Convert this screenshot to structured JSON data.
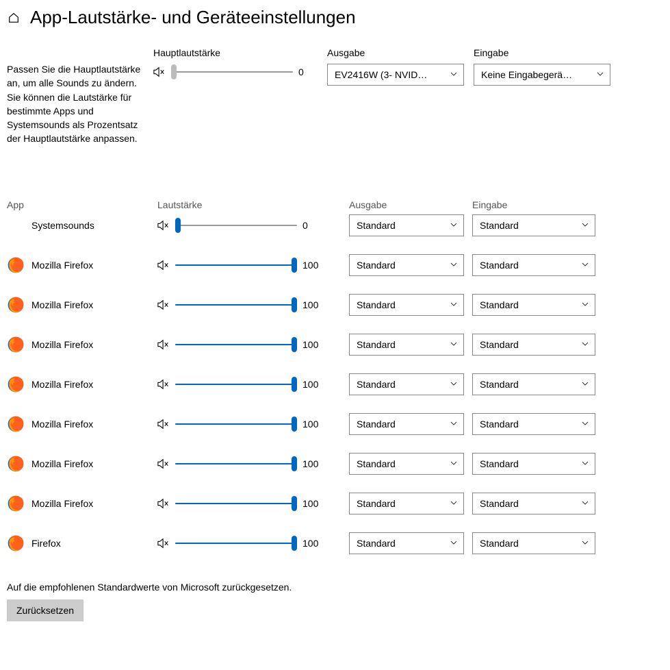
{
  "header": {
    "title": "App-Lautstärke- und Geräteeinstellungen"
  },
  "description": "Passen Sie die Hauptlautstärke an, um alle Sounds zu ändern. Sie können die Lautstärke für bestimmte Apps und Systemsounds als Prozentsatz der Hauptlautstärke anpassen.",
  "master": {
    "volume_label": "Hauptlautstärke",
    "volume_value": "0",
    "output_label": "Ausgabe",
    "output_value": "EV2416W (3- NVID…",
    "input_label": "Eingabe",
    "input_value": "Keine Eingabegerä…"
  },
  "list_headers": {
    "app": "App",
    "volume": "Lautstärke",
    "output": "Ausgabe",
    "input": "Eingabe"
  },
  "apps": [
    {
      "name": "Systemsounds",
      "icon": "none",
      "volume": "0",
      "output": "Standard",
      "input": "Standard"
    },
    {
      "name": "Mozilla Firefox",
      "icon": "firefox",
      "volume": "100",
      "output": "Standard",
      "input": "Standard"
    },
    {
      "name": "Mozilla Firefox",
      "icon": "firefox",
      "volume": "100",
      "output": "Standard",
      "input": "Standard"
    },
    {
      "name": "Mozilla Firefox",
      "icon": "firefox",
      "volume": "100",
      "output": "Standard",
      "input": "Standard"
    },
    {
      "name": "Mozilla Firefox",
      "icon": "firefox",
      "volume": "100",
      "output": "Standard",
      "input": "Standard"
    },
    {
      "name": "Mozilla Firefox",
      "icon": "firefox",
      "volume": "100",
      "output": "Standard",
      "input": "Standard"
    },
    {
      "name": "Mozilla Firefox",
      "icon": "firefox",
      "volume": "100",
      "output": "Standard",
      "input": "Standard"
    },
    {
      "name": "Mozilla Firefox",
      "icon": "firefox",
      "volume": "100",
      "output": "Standard",
      "input": "Standard"
    },
    {
      "name": "Firefox",
      "icon": "firefox",
      "volume": "100",
      "output": "Standard",
      "input": "Standard"
    }
  ],
  "reset": {
    "text": "Auf die empfohlenen Standardwerte von Microsoft zurückgesetzen.",
    "button": "Zurücksetzen"
  }
}
